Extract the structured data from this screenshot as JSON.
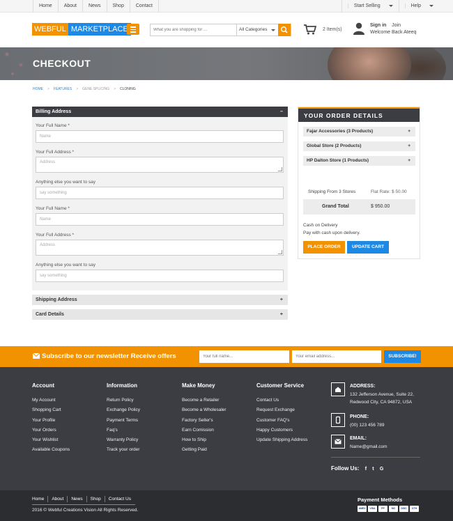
{
  "topbar": {
    "nav": [
      "Home",
      "About",
      "News",
      "Shop",
      "Contact"
    ],
    "start_selling": "Start Selling",
    "help": "Help"
  },
  "header": {
    "logo_part1": "WEBFUL",
    "logo_part2": "MARKETPLACE",
    "search_placeholder": "What you are shopping for ...",
    "category_selected": "All Categories",
    "cart_count": "2 Item(s)",
    "signin": "Sign in",
    "join": "Join",
    "welcome": "Welcome Back Ateeq"
  },
  "banner": {
    "title": "CHECKOUT"
  },
  "breadcrumb": [
    "HOME",
    "FEATURES",
    "GENE SPLICING",
    "CLONING"
  ],
  "billing": {
    "title": "Billing Address",
    "toggle": "–",
    "fields": [
      {
        "label": "Your Full Name *",
        "placeholder": "Name"
      },
      {
        "label": "Your Full Address *",
        "placeholder": "Address"
      },
      {
        "label": "Anything else you want to say",
        "placeholder": "say something"
      },
      {
        "label": "Your Full Name *",
        "placeholder": "Name"
      },
      {
        "label": "Your Full Address *",
        "placeholder": "Address"
      },
      {
        "label": "Anything else you want to say",
        "placeholder": "say something"
      }
    ]
  },
  "sections": [
    {
      "title": "Shipping Address",
      "toggle": "+"
    },
    {
      "title": "Card Details",
      "toggle": "+"
    }
  ],
  "order": {
    "title": "YOUR ORDER DETAILS",
    "stores": [
      {
        "label": "Fajar Accessories (3 Products)",
        "toggle": "+"
      },
      {
        "label": "Global Store (2 Products)",
        "toggle": "+"
      },
      {
        "label": "HP Dalton Store (1 Products)",
        "toggle": "+"
      }
    ],
    "shipping_label": "Shipping From 3 Stores",
    "shipping_value": "Flat Rate: $ 50.00",
    "total_label": "Grand Total",
    "total_value": "$ 950.00",
    "payment_method": "Cash on Delivery",
    "payment_note": "Pay with cash upon delivery.",
    "place_order": "PLACE ORDER",
    "update_cart": "UPDATE CART"
  },
  "newsletter": {
    "text": "Subscribe to our newsletter Receive offers",
    "name_placeholder": "Your full name...",
    "email_placeholder": "Your email address...",
    "button": "SUBSCRIBE!"
  },
  "footer": {
    "columns": [
      {
        "title": "Account",
        "links": [
          "My Account",
          "Shopping Cart",
          "Your Profile",
          "Your Orders",
          "Your Wishlist",
          "Available Coupons"
        ]
      },
      {
        "title": "Information",
        "links": [
          "Return Policy",
          "Exchange Policy",
          "Payment Terms",
          "Faq's",
          "Warranty Policy",
          "Track your order"
        ]
      },
      {
        "title": "Make Money",
        "links": [
          "Become a Retailer",
          "Become a Wholesaler",
          "Factory Seller's",
          "Earn Comission",
          "How to Ship",
          "Getting Paid"
        ]
      },
      {
        "title": "Customer Service",
        "links": [
          "Contact Us",
          "Request Exchange",
          "Customer FAQ's",
          "Happy Customers",
          "Update Shipping Address"
        ]
      }
    ],
    "address_title": "ADDRESS:",
    "address_line1": "132 Jefferson Avenue, Suite 22,",
    "address_line2": "Redwood City, CA 94872, USA",
    "phone_title": "PHONE:",
    "phone": "(00) 123 456 789",
    "email_title": "EMAIL:",
    "email": "Name@gmail.com",
    "follow": "Follow Us:",
    "social": [
      "f",
      "t",
      "G"
    ]
  },
  "bottom": {
    "nav": [
      "Home",
      "About",
      "News",
      "Shop",
      "Contact Us"
    ],
    "copyright": "2016 © Webful Creations Vision All Rights Reserved.",
    "payment_title": "Payment Methods",
    "cards": [
      "AMEX",
      "VISA",
      "PP",
      "MC",
      "DISC",
      "OTH"
    ]
  }
}
